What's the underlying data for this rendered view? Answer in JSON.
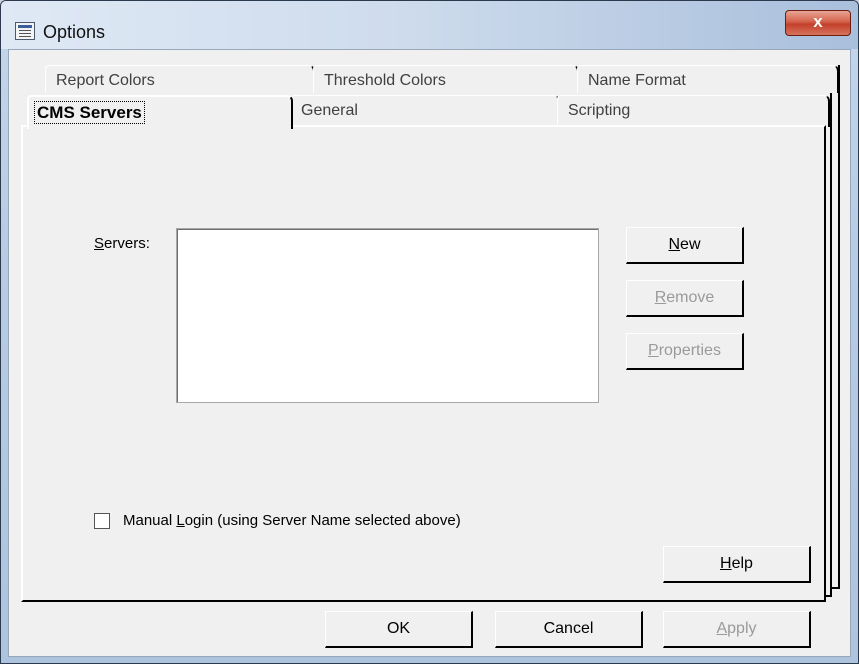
{
  "window": {
    "title": "Options",
    "close_glyph": "x"
  },
  "tabs_row_back": [
    {
      "label": "Report Colors"
    },
    {
      "label": "Threshold Colors"
    },
    {
      "label": "Name Format"
    }
  ],
  "tabs_row_front": [
    {
      "label": "CMS Servers",
      "active": true
    },
    {
      "label": "General"
    },
    {
      "label": "Scripting"
    }
  ],
  "cms": {
    "servers_label_prefix": "",
    "servers_label_mnemonic": "S",
    "servers_label_rest": "ervers:",
    "servers": [],
    "buttons": {
      "new": {
        "mnemonic": "N",
        "rest": "ew"
      },
      "remove": {
        "mnemonic": "R",
        "rest": "emove"
      },
      "properties": {
        "mnemonic": "P",
        "rest": "roperties"
      }
    },
    "manual_login": {
      "checked": false,
      "prefix": "Manual ",
      "mnemonic": "L",
      "rest": "ogin (using Server Name selected above)"
    },
    "help": {
      "mnemonic": "H",
      "rest": "elp"
    }
  },
  "dialog_buttons": {
    "ok": "OK",
    "cancel": "Cancel",
    "apply": {
      "mnemonic": "A",
      "rest": "pply"
    }
  },
  "colors": {
    "disabled_text": "#9a9a9a",
    "close_button": "#c3402a"
  },
  "icons": {
    "title": "options-window-icon",
    "close": "close-icon"
  }
}
